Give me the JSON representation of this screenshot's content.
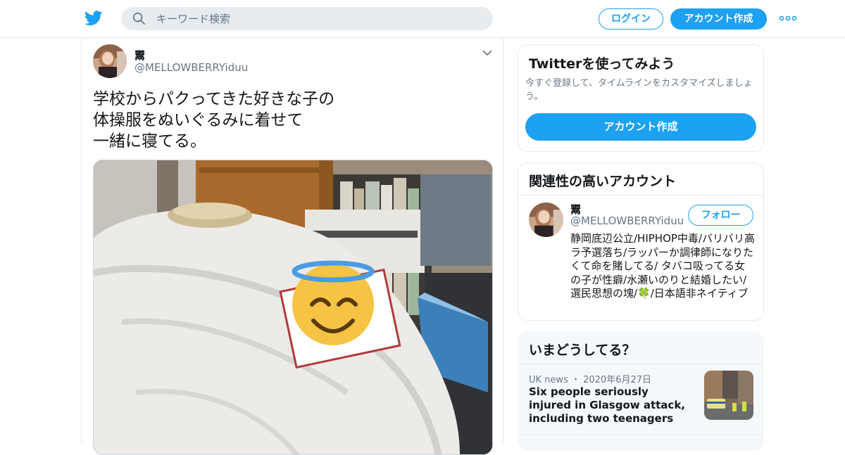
{
  "header": {
    "search_placeholder": "キーワード検索",
    "login_label": "ログイン",
    "signup_label": "アカウント作成"
  },
  "tweet": {
    "author_name": "鬻",
    "author_handle": "@MELLOWBERRYiduu",
    "text_lines": [
      "学校からパクってきた好きな子の",
      "体操服をぬいぐるみに着せて",
      "一緒に寝てる。"
    ]
  },
  "signup_card": {
    "title": "Twitterを使ってみよう",
    "description": "今すぐ登録して、タイムラインをカスタマイズしましょう。",
    "button_label": "アカウント作成"
  },
  "related_card": {
    "title": "関連性の高いアカウント",
    "account": {
      "name": "鬻",
      "handle": "@MELLOWBERRYiduu",
      "follow_label": "フォロー",
      "bio": "静岡底辺公立/HIPHOP中毒/バリバリ高ラ予選落ち/ラッパーか調律師になりたくて命を賭してる/ タバコ吸ってる女の子が性癖/水瀬いのりと結婚したい/選民思想の塊/🍀/日本語非ネイティブ"
    }
  },
  "trends_card": {
    "title": "いまどうしてる？",
    "items": [
      {
        "source": "UK news",
        "date": "2020年6月27日",
        "headline": "Six people seriously injured in Glasgow attack, including two teenagers"
      }
    ]
  },
  "colors": {
    "brand": "#1da1f2",
    "text_primary": "#14171a",
    "text_secondary": "#657786",
    "border": "#e6ecf0"
  }
}
